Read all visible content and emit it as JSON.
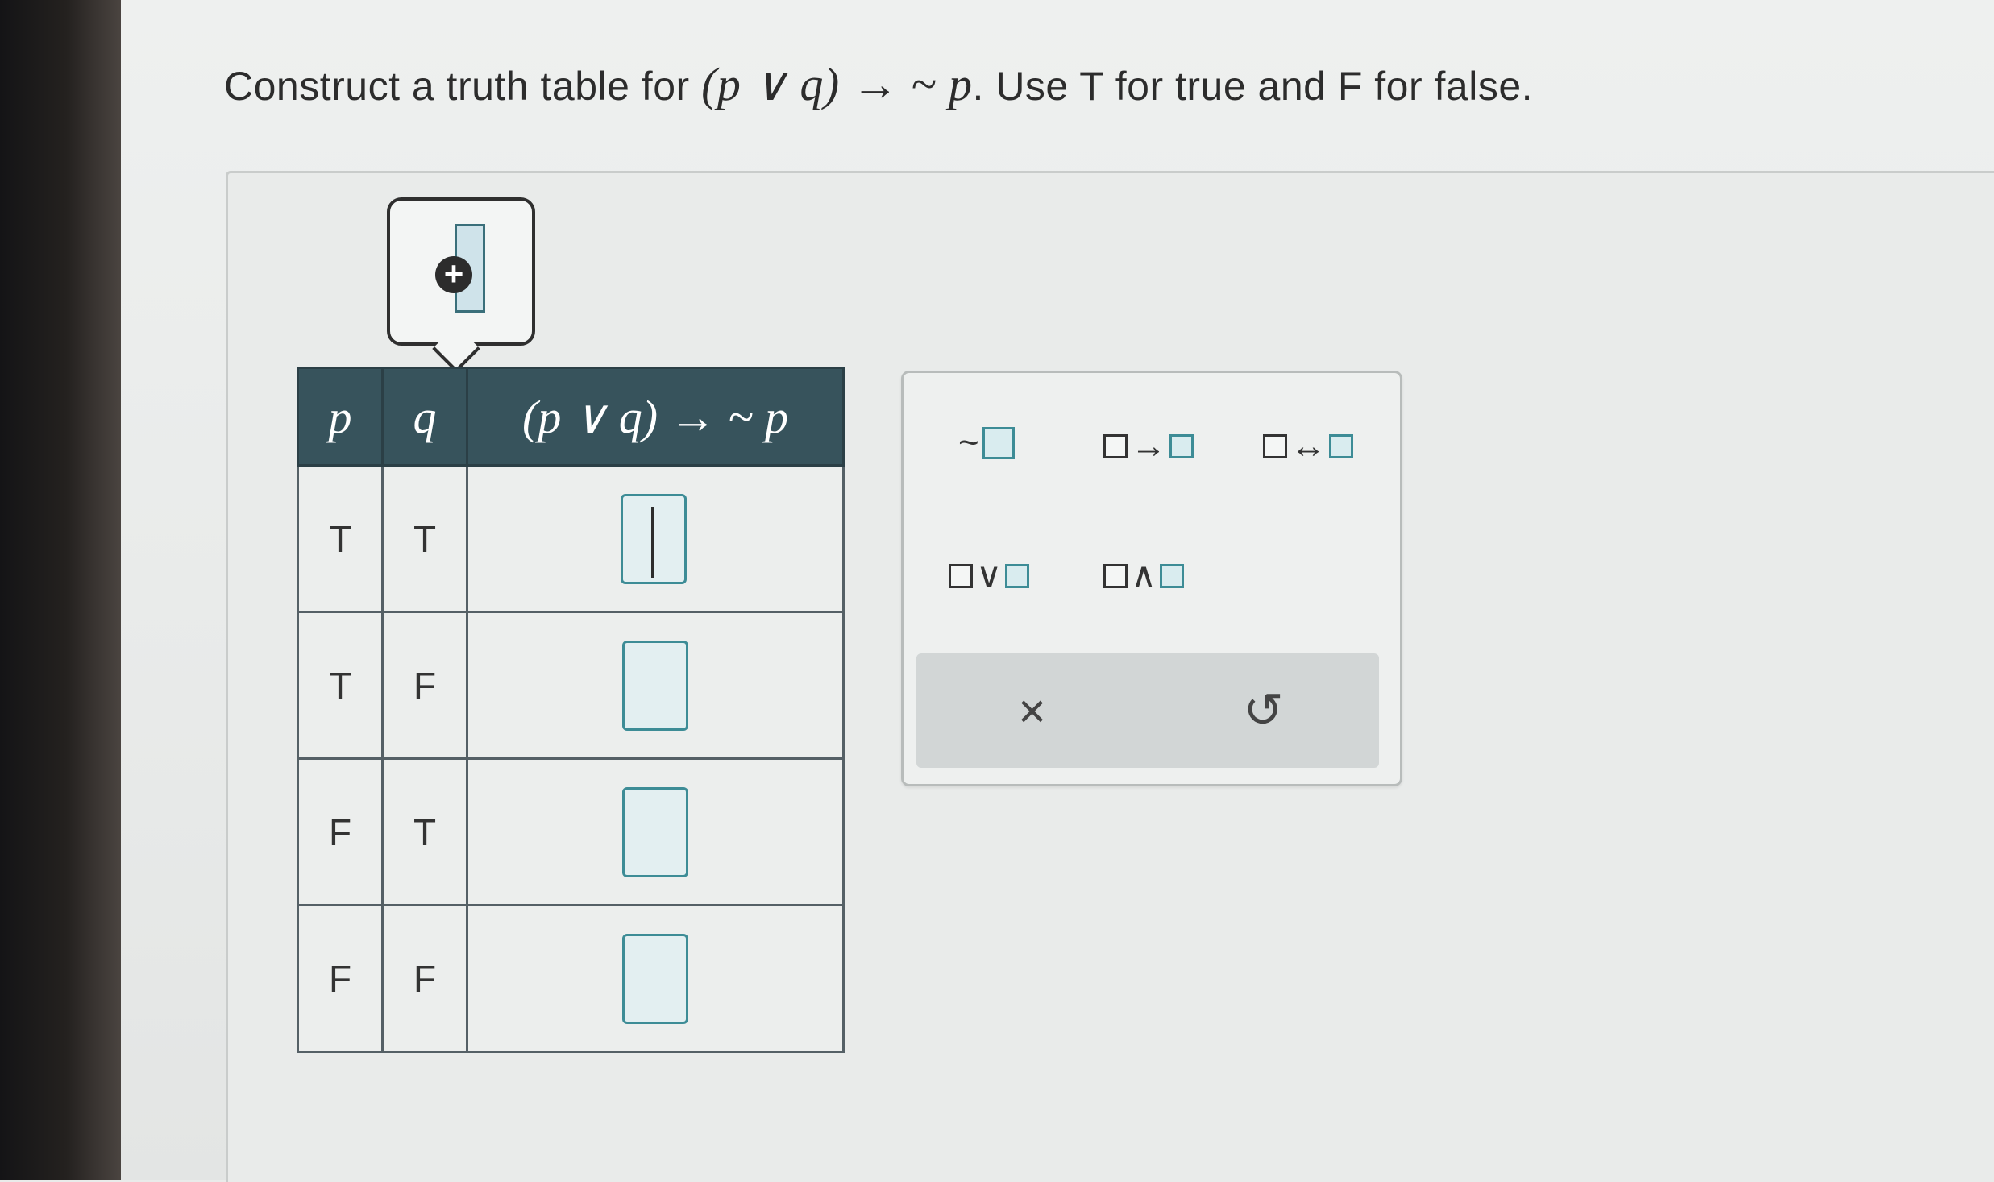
{
  "question": {
    "prefix": "Construct a truth table for ",
    "formula": "(p ∨ q) → ~ p",
    "suffix": ". Use T for true and F for false."
  },
  "tooltip": {
    "icon": "plus-circle-icon"
  },
  "truth_table": {
    "headers": [
      "p",
      "q",
      "(p ∨ q) → ~ p"
    ],
    "rows": [
      {
        "p": "T",
        "q": "T",
        "result": ""
      },
      {
        "p": "T",
        "q": "F",
        "result": ""
      },
      {
        "p": "F",
        "q": "T",
        "result": ""
      },
      {
        "p": "F",
        "q": "F",
        "result": ""
      }
    ]
  },
  "palette": {
    "negation": "~",
    "conditional": "→",
    "biconditional": "↔",
    "disjunction": "∨",
    "conjunction": "∧",
    "clear_icon": "close-icon",
    "clear_label": "×",
    "undo_icon": "undo-icon",
    "undo_label": "↺"
  },
  "colors": {
    "header_bg": "#37535c",
    "input_border": "#3d8c96"
  }
}
